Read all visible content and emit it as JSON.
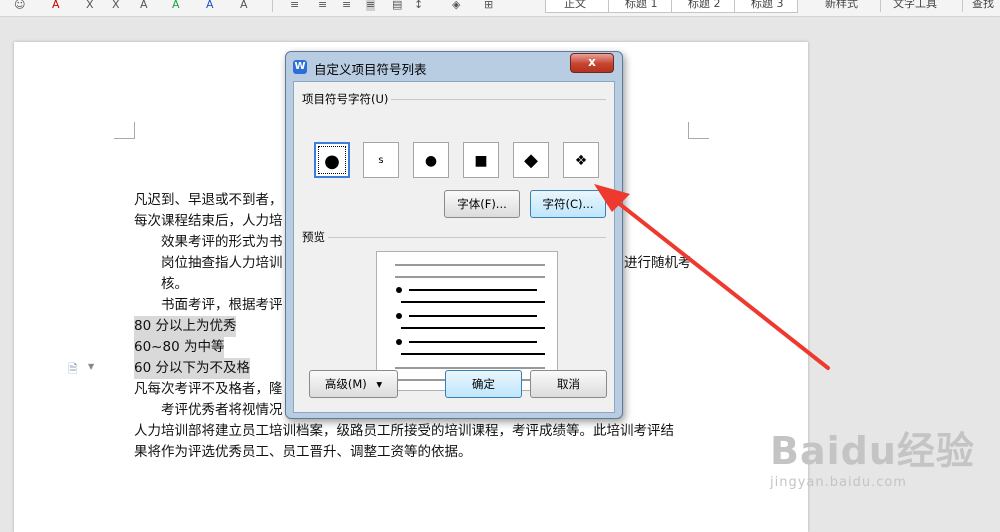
{
  "toolbar": {
    "styles": [
      "正文",
      "标题 1",
      "标题 2",
      "标题 3"
    ],
    "new_style": "新样式",
    "text_tools": "文字工具",
    "find": "查找"
  },
  "document": {
    "lines": [
      {
        "text": "凡迟到、早退或不到者，",
        "indent": false,
        "highlight": false
      },
      {
        "text": "每次课程结束后，人力培",
        "indent": false,
        "highlight": false
      },
      {
        "text": "效果考评的形式为书",
        "indent": true,
        "highlight": false
      },
      {
        "text": "岗位抽查指人力培训",
        "indent": true,
        "highlight": false
      },
      {
        "text": "核。",
        "indent": true,
        "highlight": false
      },
      {
        "text": "书面考评，根据考评",
        "indent": true,
        "highlight": false
      },
      {
        "text": "80 分以上为优秀",
        "indent": false,
        "highlight": true
      },
      {
        "text": "60~80 为中等",
        "indent": false,
        "highlight": true
      },
      {
        "text": "60 分以下为不及格",
        "indent": false,
        "highlight": true
      },
      {
        "text": "凡每次考评不及格者，隆",
        "indent": false,
        "highlight": false
      },
      {
        "text": "考评优秀者将视情况",
        "indent": true,
        "highlight": false
      },
      {
        "text": "人力培训部将建立员工培训档案，级路员工所接受的培训课程，考评成绩等。此培训考评结",
        "indent": false,
        "highlight": false
      },
      {
        "text": "果将作为评选优秀员工、员工晋升、调整工资等的依据。",
        "indent": false,
        "highlight": false
      }
    ],
    "line_fragment_right": "进行随机考"
  },
  "dialog": {
    "title": "自定义项目符号列表",
    "close_label": "x",
    "group_symbols": "项目符号字符(U)",
    "symbols": [
      "●",
      "s",
      "●",
      "■",
      "◆",
      "❖"
    ],
    "font_button": "字体(F)...",
    "char_button": "字符(C)...",
    "group_preview": "预览",
    "advanced_button": "高级(M)",
    "advanced_arrow": "▾",
    "ok_button": "确定",
    "cancel_button": "取消"
  },
  "watermark": {
    "main": "Baidu经验",
    "sub": "jingyan.baidu.com"
  },
  "colors": {
    "arrow": "#ee3a2e",
    "dialog_frame": "#b8cde2",
    "selection_blue": "#3c7fd8"
  }
}
